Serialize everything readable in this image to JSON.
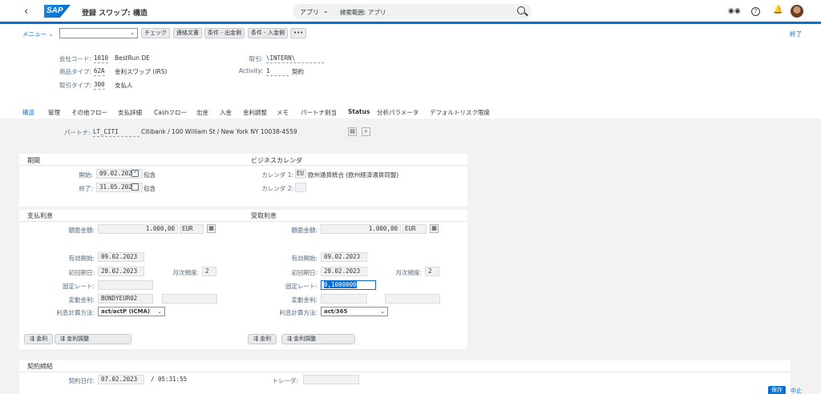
{
  "shell": {
    "back": "‹",
    "logo": "SAP",
    "title": "登録 スワップ: 構造",
    "search_scope": "アプリ",
    "search_placeholder": "検索範囲: アプリ",
    "icons": [
      "binoculars-icon",
      "help-icon",
      "bell-icon",
      "avatar"
    ]
  },
  "toolbar": {
    "menu": "メニュー",
    "buttons": [
      "チェック",
      "連絡文書",
      "条件 - 出金側",
      "条件 - 入金側",
      "•••"
    ],
    "exit": "終了"
  },
  "header": {
    "company_code_label": "会社コード:",
    "company_code": "1010",
    "company_name": "BestRun DE",
    "product_type_label": "商品タイプ:",
    "product_type": "62A",
    "product_name": "金利スワップ (IRS)",
    "txn_type_label": "取引タイプ:",
    "txn_type": "300",
    "txn_name": "支払人",
    "deal_label": "取引:",
    "deal": "\\INTERN\\",
    "activity_label": "Activity:",
    "activity": "1",
    "activity_name": "契約"
  },
  "tabs": [
    "構造",
    "管理",
    "その他フロー",
    "支払詳細",
    "Cashフロー",
    "出金",
    "入金",
    "金利調整",
    "メモ",
    "パートナ割当",
    "Status",
    "分析パラメータ",
    "デフォルトリスク限度"
  ],
  "partner": {
    "label": "パートナ:",
    "value": "LT_CITI",
    "address": "Citibank / 100 William St / New York NY 10038-4559"
  },
  "period": {
    "title": "期間",
    "start_label": "開始:",
    "start": "09.02.2023",
    "start_incl": "包含",
    "end_label": "終了:",
    "end": "31.05.2023",
    "end_incl": "包含"
  },
  "calendar": {
    "title": "ビジネスカレンダ",
    "cal1_label": "カレンダ 1:",
    "cal1": "EU",
    "cal1_name": "欧州通貨統合 (欧州経済通貨同盟)",
    "cal2_label": "カレンダ 2:"
  },
  "pay": {
    "title": "支払利息",
    "nominal_label": "額面金額:",
    "nominal": "1.000,00",
    "currency": "EUR",
    "eff_start_label": "有効開始:",
    "eff_start": "09.02.2023",
    "first_due_label": "初回期日:",
    "first_due": "28.02.2023",
    "freq_label": "月次頻度:",
    "freq": "2",
    "fixed_label": "固定レート:",
    "fixed": "",
    "var_label": "変動金利:",
    "var": "BONDYEUR02",
    "plusminus": "+/-:",
    "method_label": "利息計算方法:",
    "method": "act/actP (ICMA)",
    "btn_rate": "金利",
    "btn_adj": "金利調整"
  },
  "recv": {
    "title": "受取利息",
    "nominal_label": "額面金額:",
    "nominal": "1.000,00",
    "currency": "EUR",
    "eff_start_label": "有効開始:",
    "eff_start": "09.02.2023",
    "first_due_label": "初回期日:",
    "first_due": "28.02.2023",
    "freq_label": "月次頻度:",
    "freq": "2",
    "fixed_label": "固定レート:",
    "fixed": "0,1000000",
    "var_label": "変動金利:",
    "var": "",
    "plusminus": "+/-:",
    "method_label": "利息計算方法:",
    "method": "act/365",
    "btn_rate": "金利",
    "btn_adj": "金利調整"
  },
  "contract": {
    "title": "契約締結",
    "date_label": "契約日付:",
    "date": "07.02.2023",
    "time": "/ 05:31:55",
    "trader_label": "トレーダ:"
  },
  "footer": {
    "save": "保存",
    "cancel": "中止"
  }
}
